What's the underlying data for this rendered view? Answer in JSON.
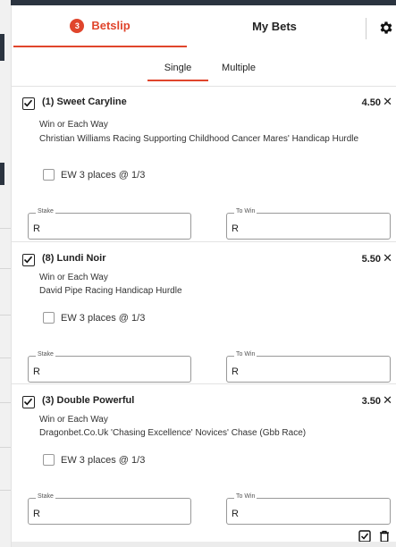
{
  "tabs": {
    "betslip_label": "Betslip",
    "betslip_count": "3",
    "mybets_label": "My Bets"
  },
  "subtabs": {
    "single_label": "Single",
    "multiple_label": "Multiple",
    "active": "Single"
  },
  "bets": [
    {
      "selection": "(1) Sweet Caryline",
      "odds": "4.50",
      "market": "Win or Each Way",
      "event": "Christian Williams Racing Supporting Childhood Cancer Mares' Handicap Hurdle",
      "ew_label": "EW 3 places @ 1/3",
      "ew_checked": false,
      "selected": true,
      "stake_label": "Stake",
      "stake_value": "R",
      "towin_label": "To Win",
      "towin_value": "R"
    },
    {
      "selection": "(8) Lundi Noir",
      "odds": "5.50",
      "market": "Win or Each Way",
      "event": "David Pipe Racing Handicap Hurdle",
      "ew_label": "EW 3 places @ 1/3",
      "ew_checked": false,
      "selected": true,
      "stake_label": "Stake",
      "stake_value": "R",
      "towin_label": "To Win",
      "towin_value": "R"
    },
    {
      "selection": "(3) Double Powerful",
      "odds": "3.50",
      "market": "Win or Each Way",
      "event": "Dragonbet.Co.Uk 'Chasing Excellence' Novices' Chase (Gbb Race)",
      "ew_label": "EW 3 places @ 1/3",
      "ew_checked": false,
      "selected": true,
      "stake_label": "Stake",
      "stake_value": "R",
      "towin_label": "To Win",
      "towin_value": "R"
    }
  ],
  "icons": {
    "settings": "gear-icon",
    "remove": "close-icon",
    "select_all": "checkbox-icon",
    "delete": "trash-icon"
  },
  "colors": {
    "accent": "#e0452c",
    "dark_nav": "#2b3440"
  }
}
